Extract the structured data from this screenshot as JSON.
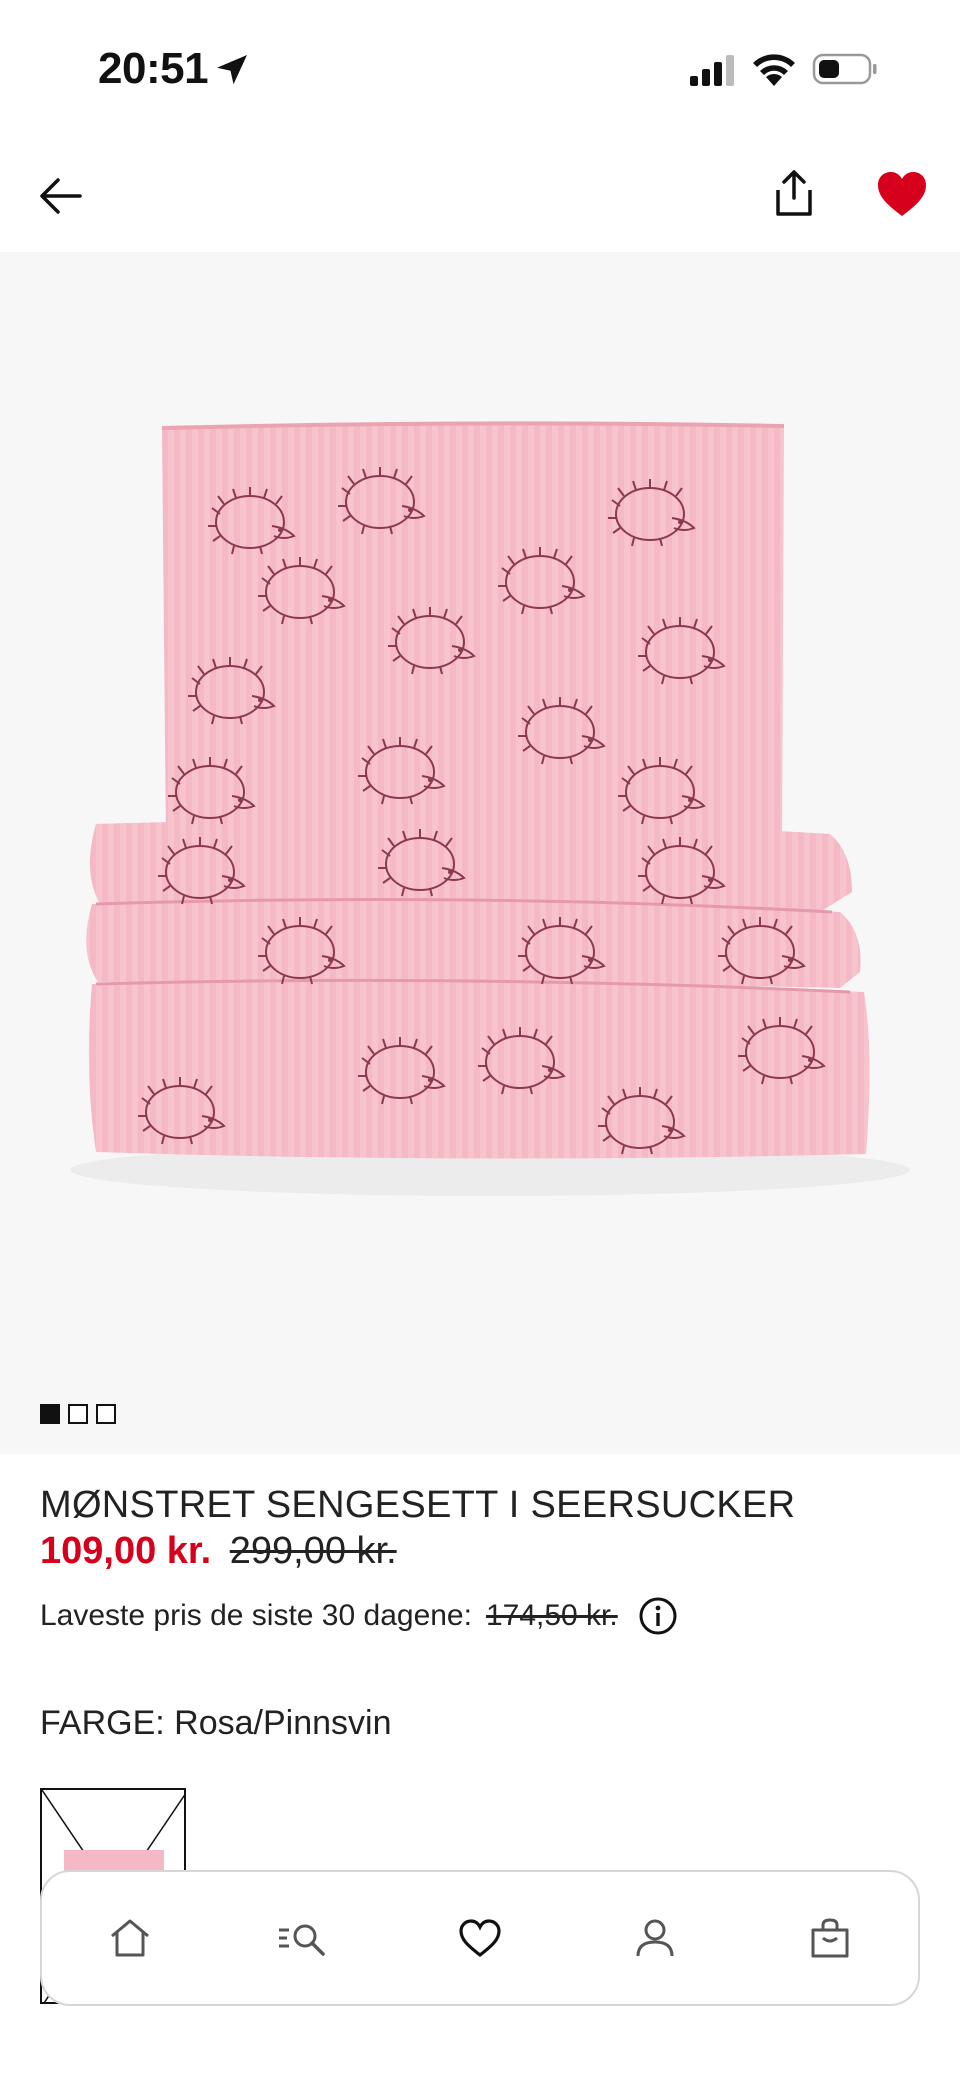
{
  "status_bar": {
    "time": "20:51"
  },
  "product": {
    "title": "MØNSTRET SENGESETT I SEERSUCKER",
    "price_sale": "109,00 kr.",
    "price_original": "299,00 kr.",
    "lowest_price_label": "Laveste pris de siste 30 dagene:",
    "lowest_price_value": "174,50 kr.",
    "color_label": "FARGE: Rosa/Pinnsvin",
    "favorited": true
  },
  "gallery": {
    "image_count": 3,
    "active_index": 0
  },
  "tabbar": {
    "items": [
      "home-icon",
      "search-icon",
      "favorites-icon",
      "account-icon",
      "bag-icon"
    ]
  },
  "colors": {
    "accent_red": "#d6001c",
    "fabric_pink": "#f4b9c4",
    "print_color": "#8a3a4a"
  }
}
